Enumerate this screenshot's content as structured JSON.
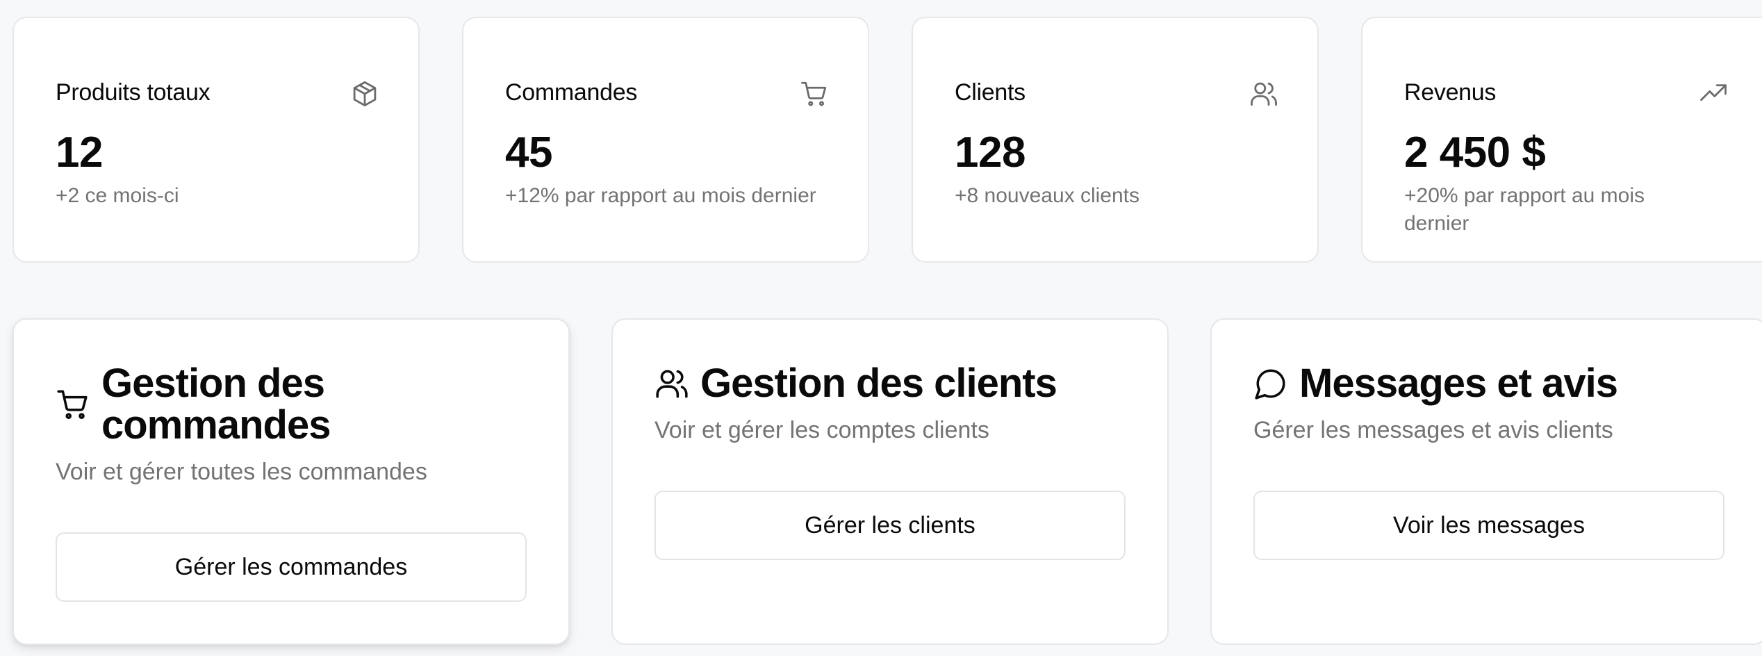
{
  "stats": [
    {
      "title": "Produits totaux",
      "value": "12",
      "sub": "+2 ce mois-ci",
      "icon": "package-icon"
    },
    {
      "title": "Commandes",
      "value": "45",
      "sub": "+12% par rapport au mois dernier",
      "icon": "shopping-cart-icon"
    },
    {
      "title": "Clients",
      "value": "128",
      "sub": "+8 nouveaux clients",
      "icon": "users-icon"
    },
    {
      "title": "Revenus",
      "value": "2 450 $",
      "sub": "+20% par rapport au mois dernier",
      "icon": "trending-up-icon"
    }
  ],
  "features": [
    {
      "title": "Gestion des commandes",
      "description": "Voir et gérer toutes les commandes",
      "button": "Gérer les commandes",
      "icon": "shopping-cart-icon"
    },
    {
      "title": "Gestion des clients",
      "description": "Voir et gérer les comptes clients",
      "button": "Gérer les clients",
      "icon": "users-icon"
    },
    {
      "title": "Messages et avis",
      "description": "Gérer les messages et avis clients",
      "button": "Voir les messages",
      "icon": "message-circle-icon"
    }
  ],
  "colors": {
    "background": "#f7f8fa",
    "card": "#ffffff",
    "border": "#e6e7ea",
    "text": "#0a0a0a",
    "muted": "#737373"
  }
}
